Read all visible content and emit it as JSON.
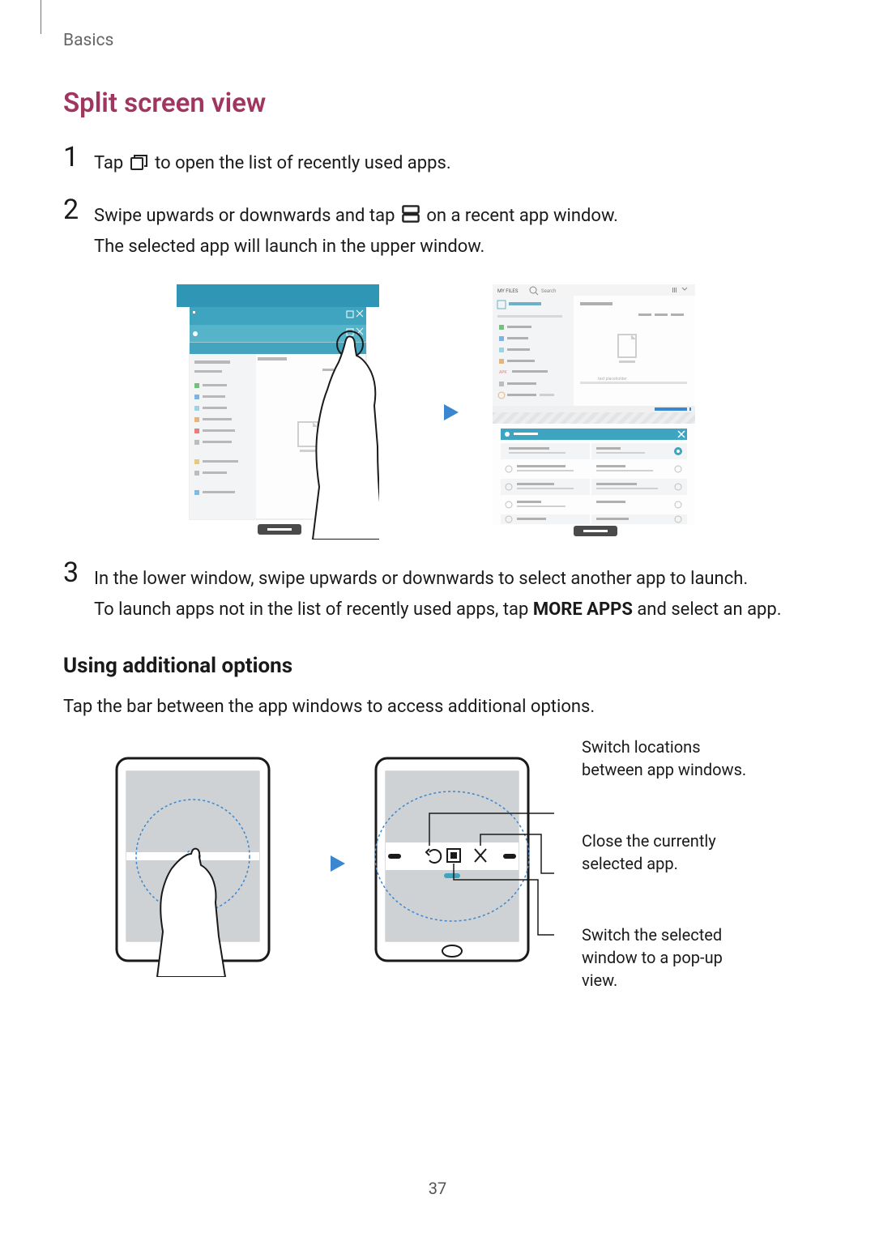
{
  "header": "Basics",
  "title": "Split screen view",
  "steps": [
    {
      "num": "1",
      "pre": "Tap ",
      "post": " to open the list of recently used apps."
    },
    {
      "num": "2",
      "line1_pre": "Swipe upwards or downwards and tap ",
      "line1_post": " on a recent app window.",
      "line2": "The selected app will launch in the upper window."
    },
    {
      "num": "3",
      "line1": "In the lower window, swipe upwards or downwards to select another app to launch.",
      "line2_pre": "To launch apps not in the list of recently used apps, tap ",
      "line2_bold": "MORE APPS",
      "line2_post": " and select an app."
    }
  ],
  "subheading": "Using additional options",
  "options_text": "Tap the bar between the app windows to access additional options.",
  "callouts": {
    "c1": "Switch locations between app windows.",
    "c2": "Close the currently selected app.",
    "c3": "Switch the selected window to a pop-up view."
  },
  "page_number": "37"
}
